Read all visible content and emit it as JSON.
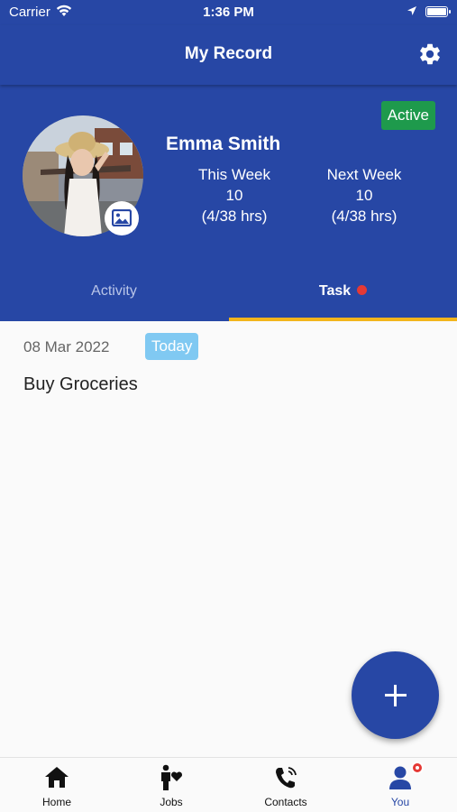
{
  "status_bar": {
    "carrier": "Carrier",
    "time": "1:36 PM"
  },
  "app_bar": {
    "title": "My Record",
    "settings_icon": "gear-icon"
  },
  "profile": {
    "name": "Emma Smith",
    "status_badge": "Active",
    "this_week": {
      "label": "This Week",
      "count": "10",
      "hours": "(4/38 hrs)"
    },
    "next_week": {
      "label": "Next Week",
      "count": "10",
      "hours": "(4/38 hrs)"
    }
  },
  "tabs": [
    {
      "label": "Activity",
      "selected": false
    },
    {
      "label": "Task",
      "selected": true,
      "has_dot": true
    }
  ],
  "task_list": {
    "date": "08 Mar 2022",
    "date_badge": "Today",
    "items": [
      {
        "title": "Buy Groceries"
      }
    ]
  },
  "fab": {
    "icon": "plus-icon"
  },
  "bottom_nav": {
    "items": [
      {
        "label": "Home",
        "icon": "home-icon"
      },
      {
        "label": "Jobs",
        "icon": "jobs-icon"
      },
      {
        "label": "Contacts",
        "icon": "phone-icon"
      },
      {
        "label": "You",
        "icon": "user-icon",
        "active": true
      }
    ]
  },
  "colors": {
    "primary": "#2747a5",
    "active_green": "#1e9a4c",
    "today_blue": "#80c9f2",
    "indicator_yellow": "#f2b51c",
    "badge_red": "#e53935"
  }
}
